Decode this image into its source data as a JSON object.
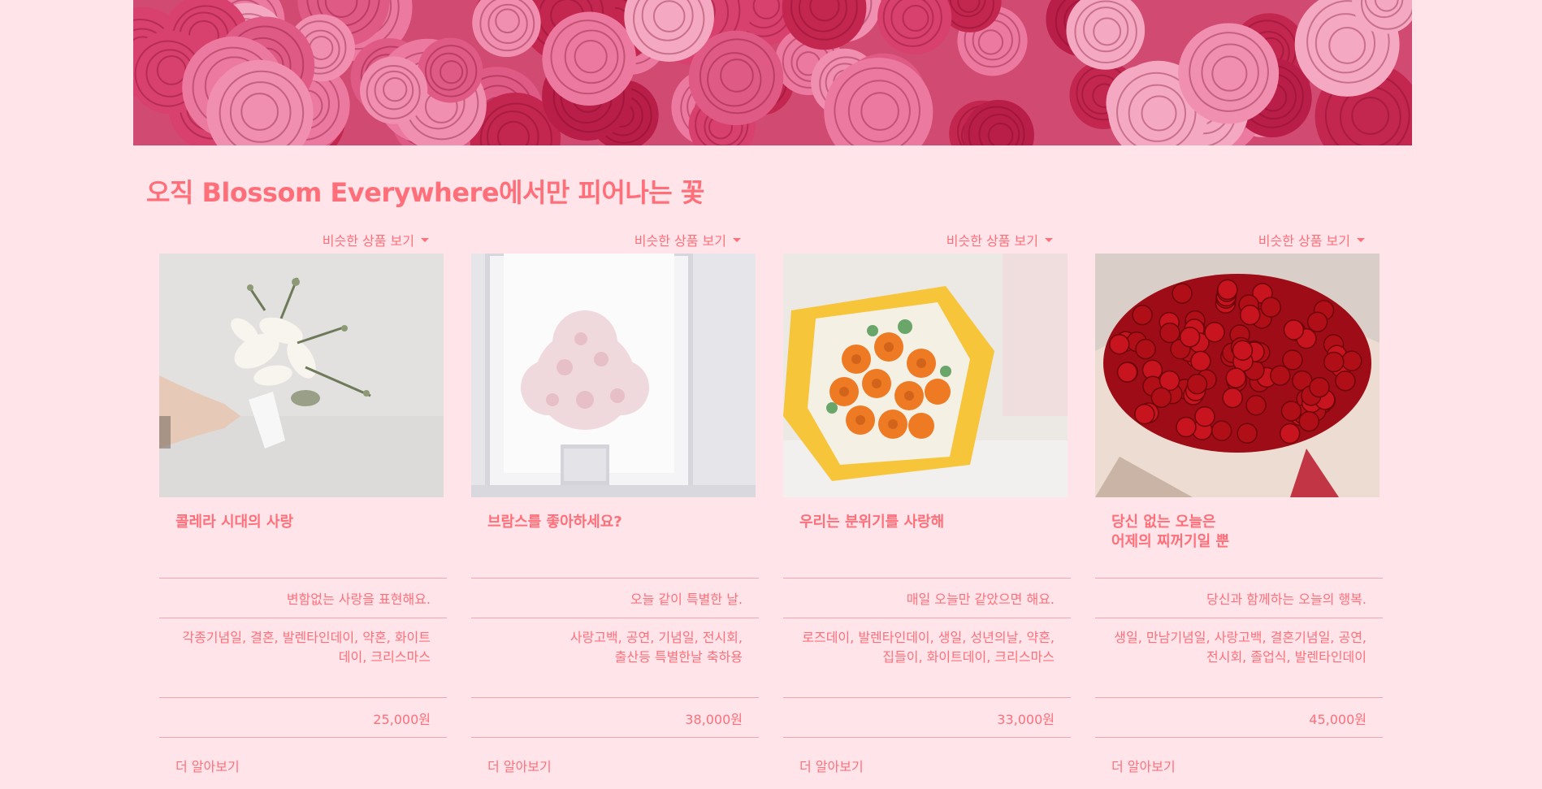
{
  "section_title": "오직 Blossom Everywhere에서만 피어나는 꽃",
  "colors": {
    "accent": "#ff6f7a",
    "background": "#ffe5ea",
    "divider": "#f6a4ae"
  },
  "products": [
    {
      "dropdown_label": "비슷한 상품 보기",
      "image": "white-calla-lily-bouquet",
      "title_lines": [
        "콜레라 시대의 사랑",
        ""
      ],
      "description": "변함없는 사랑을 표현해요.",
      "tags_lines": [
        "각종기념일, 결혼, 발렌타인데이, 약혼, 화이트",
        "데이, 크리스마스"
      ],
      "price": "25,000원",
      "more_label": "더 알아보기"
    },
    {
      "dropdown_label": "비슷한 상품 보기",
      "image": "pink-hydrangea-vase",
      "title_lines": [
        "브람스를 좋아하세요?",
        ""
      ],
      "description": "오늘 같이 특별한 날.",
      "tags_lines": [
        "사랑고백, 공연, 기념일, 전시회,",
        "출산등 특별한날 축하용"
      ],
      "price": "38,000원",
      "more_label": "더 알아보기"
    },
    {
      "dropdown_label": "비슷한 상품 보기",
      "image": "orange-rose-bouquet",
      "title_lines": [
        "우리는 분위기를 사랑해",
        ""
      ],
      "description": "매일 오늘만 같았으면 해요.",
      "tags_lines": [
        "로즈데이, 발렌타인데이, 생일, 성년의날, 약혼,",
        "집들이, 화이트데이, 크리스마스"
      ],
      "price": "33,000원",
      "more_label": "더 알아보기"
    },
    {
      "dropdown_label": "비슷한 상품 보기",
      "image": "red-rose-bouquet",
      "title_lines": [
        "당신 없는 오늘은",
        "어제의 찌꺼기일 뿐"
      ],
      "description": "당신과 함께하는 오늘의 행복.",
      "tags_lines": [
        "생일, 만남기념일, 사랑고백, 결혼기념일, 공연,",
        "전시회, 졸업식, 발렌타인데이"
      ],
      "price": "45,000원",
      "more_label": "더 알아보기"
    }
  ]
}
